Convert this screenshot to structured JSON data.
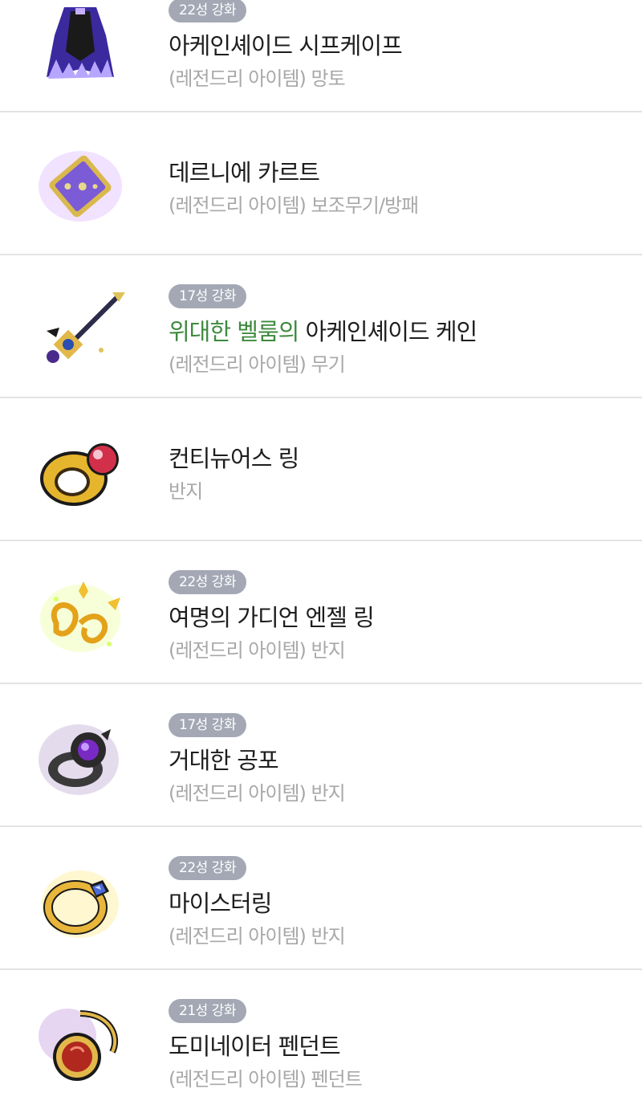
{
  "items": [
    {
      "badge": "22성 강화",
      "prefix": "",
      "name": "아케인셰이드 시프케이프",
      "category": "(레전드리 아이템) 망토",
      "icon": "cape-icon"
    },
    {
      "badge": "",
      "prefix": "",
      "name": "데르니에 카르트",
      "category": "(레전드리 아이템) 보조무기/방패",
      "icon": "card-icon"
    },
    {
      "badge": "17성 강화",
      "prefix": "위대한 벨룸의",
      "name": "아케인셰이드 케인",
      "category": "(레전드리 아이템) 무기",
      "icon": "cane-icon"
    },
    {
      "badge": "",
      "prefix": "",
      "name": "컨티뉴어스 링",
      "category": "반지",
      "icon": "ring-icon"
    },
    {
      "badge": "22성 강화",
      "prefix": "",
      "name": "여명의 가디언 엔젤 링",
      "category": "(레전드리 아이템) 반지",
      "icon": "angel-ring-icon"
    },
    {
      "badge": "17성 강화",
      "prefix": "",
      "name": "거대한 공포",
      "category": "(레전드리 아이템) 반지",
      "icon": "dark-ring-icon"
    },
    {
      "badge": "22성 강화",
      "prefix": "",
      "name": "마이스터링",
      "category": "(레전드리 아이템) 반지",
      "icon": "meister-ring-icon"
    },
    {
      "badge": "21성 강화",
      "prefix": "",
      "name": "도미네이터 펜던트",
      "category": "(레전드리 아이템) 펜던트",
      "icon": "pendant-icon"
    }
  ]
}
